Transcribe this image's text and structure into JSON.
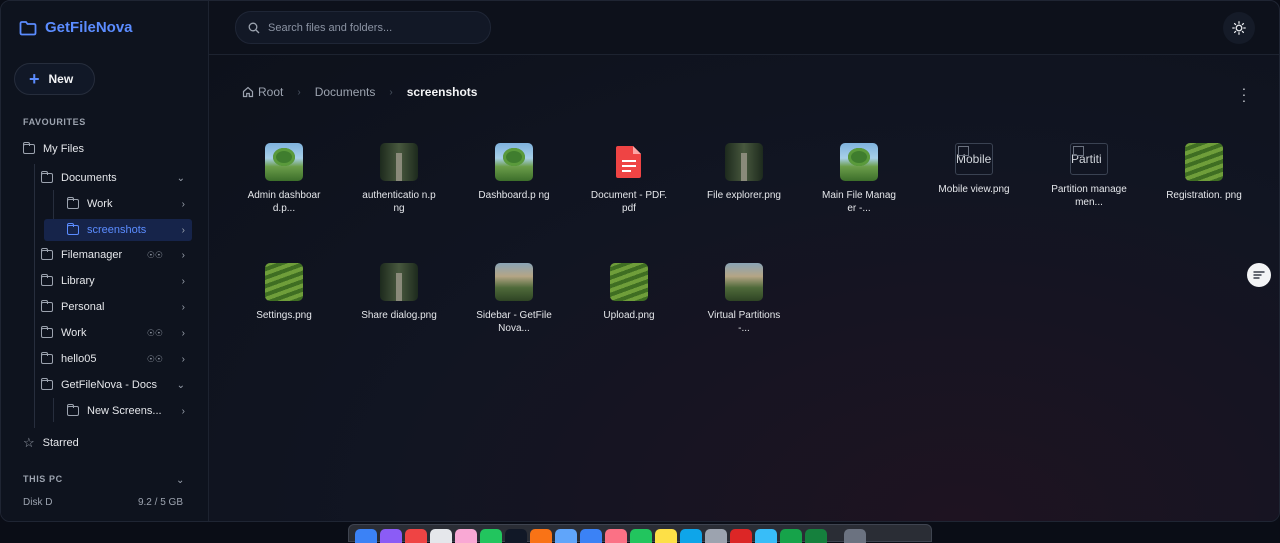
{
  "app": {
    "name": "GetFileNova",
    "new_label": "New"
  },
  "sidebar": {
    "favourites_label": "FAVOURITES",
    "my_files": "My Files",
    "items": [
      {
        "label": "Documents",
        "chevron": "⌄"
      },
      {
        "label": "Work",
        "chevron": "›"
      },
      {
        "label": "screenshots",
        "chevron": "›"
      },
      {
        "label": "Filemanager",
        "chevron": "›",
        "shared": true
      },
      {
        "label": "Library",
        "chevron": "›"
      },
      {
        "label": "Personal",
        "chevron": "›"
      },
      {
        "label": "Work",
        "chevron": "›",
        "shared": true
      },
      {
        "label": "hello05",
        "chevron": "›",
        "shared": true
      },
      {
        "label": "GetFileNova - Docs",
        "chevron": "⌄"
      },
      {
        "label": "New Screens...",
        "chevron": "›"
      }
    ],
    "starred": "Starred",
    "this_pc_label": "THIS PC",
    "disk_label": "Disk D",
    "disk_size": "9.2 / 5 GB"
  },
  "search": {
    "placeholder": "Search files and folders..."
  },
  "breadcrumb": {
    "root": "Root",
    "middle": "Documents",
    "current": "screenshots"
  },
  "files": [
    {
      "name": "Admin dashboard.p...",
      "thumb": "tree"
    },
    {
      "name": "authenticatio n.png",
      "thumb": "bridge"
    },
    {
      "name": "Dashboard.p ng",
      "thumb": "tree"
    },
    {
      "name": "Document - PDF.pdf",
      "thumb": "pdf"
    },
    {
      "name": "File explorer.png",
      "thumb": "bridge"
    },
    {
      "name": "Main File Manager -...",
      "thumb": "tree"
    },
    {
      "name": "Mobile view.png",
      "thumb": "broken",
      "alt": "Mobile"
    },
    {
      "name": "Partition managemen...",
      "thumb": "broken",
      "alt": "Partiti"
    },
    {
      "name": "Registration. png",
      "thumb": "field"
    },
    {
      "name": "Settings.png",
      "thumb": "field"
    },
    {
      "name": "Share dialog.png",
      "thumb": "bridge"
    },
    {
      "name": "Sidebar - GetFileNova...",
      "thumb": "valley"
    },
    {
      "name": "Upload.png",
      "thumb": "field"
    },
    {
      "name": "Virtual Partitions -...",
      "thumb": "valley"
    }
  ],
  "colors": {
    "accent": "#5b8cff",
    "pdf": "#ef4444"
  }
}
